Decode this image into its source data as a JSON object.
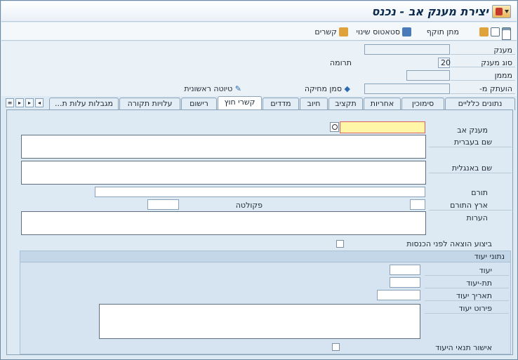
{
  "window": {
    "title": "יצירת מענק אב - נכנס"
  },
  "toolbar": {
    "items": [
      {
        "label": "מתן תוקף",
        "icon": "validate-icon"
      },
      {
        "label": "סטאטוס שינוי",
        "icon": "status-icon"
      },
      {
        "label": "קשרים",
        "icon": "relations-icon"
      }
    ]
  },
  "header": {
    "grant_label": "מענק",
    "grant_value": "",
    "grant_type_label": "סוג מענק",
    "grant_type_value": "20",
    "grant_type_desc": "תרומה",
    "funder_label": "מממן",
    "copied_from_label": "הועתק מ-",
    "delete_mark_label": "סמן מחיקה",
    "first_draft_label": "טיוטה ראשונית"
  },
  "tabs": [
    "נתונים כלליים",
    "סימוכין",
    "אחריות",
    "תקציב",
    "חיוב",
    "מדדים",
    "קשרי חוץ",
    "רישום",
    "עלויות תקורה",
    "מגבלות עלות ת..."
  ],
  "form": {
    "parent_grant_label": "מענק אב",
    "parent_grant_value": "",
    "hebrew_name_label": "שם בעברית",
    "english_name_label": "שם באנגלית",
    "donor_label": "תורם",
    "donor_country_label": "ארץ התורם",
    "faculty_label": "פקולטה",
    "notes_label": "הערות",
    "pre_income_label": "ביצוע הוצאה לפני הכנסות"
  },
  "purpose_section": {
    "title": "נתוני יעוד",
    "purpose_label": "יעוד",
    "sub_purpose_label": "תת-יעוד",
    "purpose_date_label": "תאריך יעוד",
    "purpose_detail_label": "פירוט יעוד",
    "purpose_terms_label": "אישור תנאי היעוד"
  }
}
